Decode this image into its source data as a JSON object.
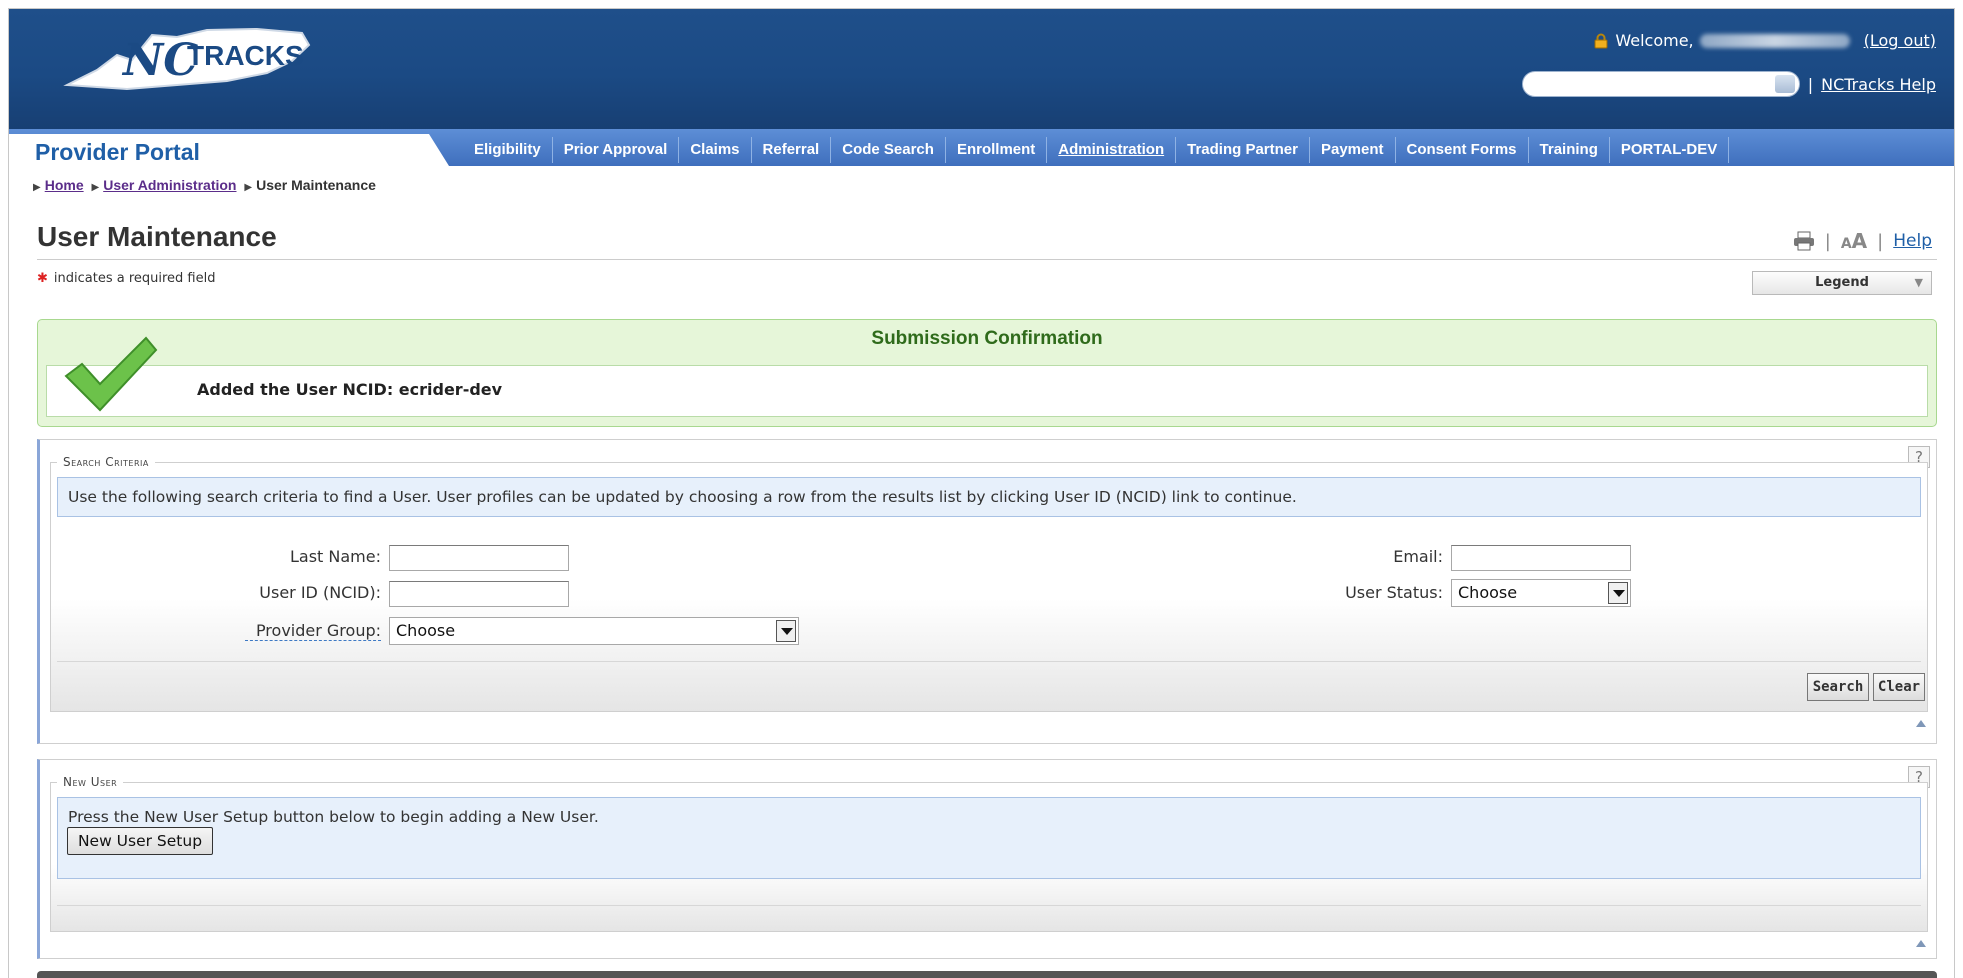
{
  "header": {
    "logo_text": "NCTRACKS",
    "welcome_label": "Welcome,",
    "logout_label": "(Log out)",
    "help_link": "NCTracks Help",
    "search_value": ""
  },
  "nav": {
    "portal_title": "Provider Portal",
    "tabs": [
      {
        "label": "Eligibility"
      },
      {
        "label": "Prior Approval"
      },
      {
        "label": "Claims"
      },
      {
        "label": "Referral"
      },
      {
        "label": "Code Search"
      },
      {
        "label": "Enrollment"
      },
      {
        "label": "Administration",
        "active": true
      },
      {
        "label": "Trading Partner"
      },
      {
        "label": "Payment"
      },
      {
        "label": "Consent Forms"
      },
      {
        "label": "Training"
      },
      {
        "label": "PORTAL-DEV"
      }
    ]
  },
  "breadcrumb": {
    "home": "Home",
    "user_admin": "User Administration",
    "current": "User Maintenance"
  },
  "page": {
    "title": "User Maintenance",
    "required_note": "indicates a required field",
    "required_star": "✱",
    "help_link": "Help",
    "legend_label": "Legend"
  },
  "confirmation": {
    "title": "Submission Confirmation",
    "message": "Added the User NCID: ecrider-dev"
  },
  "search_criteria": {
    "legend": "Search Criteria",
    "info": "Use the following search criteria to find a User. User profiles can be updated by choosing a row from the results list by clicking User ID (NCID) link to continue.",
    "last_name_label": "Last Name:",
    "last_name_value": "",
    "user_id_label": "User ID (NCID):",
    "user_id_value": "",
    "provider_group_label": "Provider Group:",
    "provider_group_value": "Choose",
    "email_label": "Email:",
    "email_value": "",
    "user_status_label": "User Status:",
    "user_status_value": "Choose",
    "search_button": "Search",
    "clear_button": "Clear",
    "help_glyph": "?"
  },
  "new_user": {
    "legend": "New User",
    "info": "Press the New User Setup button below to begin adding a New User.",
    "button": "New User Setup",
    "help_glyph": "?"
  },
  "colors": {
    "header_bg": "#1b4a84",
    "nav_bg": "#4a7cc8",
    "link": "#1f5fa7",
    "confirm_bg": "#e6f6d9",
    "confirm_text": "#2f6b1b"
  }
}
